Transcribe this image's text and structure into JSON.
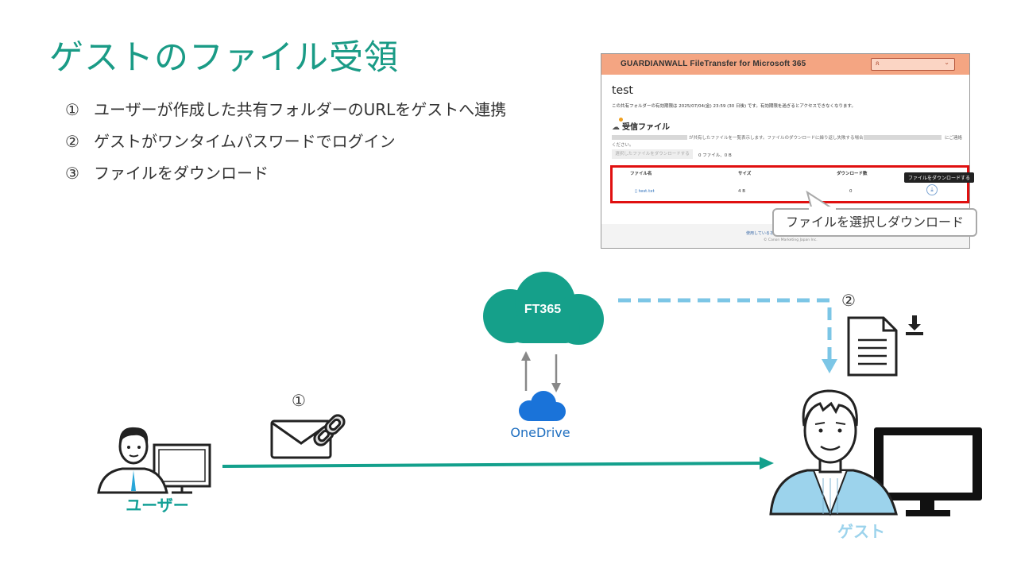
{
  "title": "ゲストのファイル受領",
  "steps": [
    {
      "num": "①",
      "text": "ユーザーが作成した共有フォルダーのURLをゲストへ連携"
    },
    {
      "num": "②",
      "text": "ゲストがワンタイムパスワードでログイン"
    },
    {
      "num": "③",
      "text": "ファイルをダウンロード"
    }
  ],
  "screenshot": {
    "brand": "GUARDIANWALL FileTransfer for Microsoft 365",
    "folder_name": "test",
    "notice": "この共有フォルダーの有効期限は 2025/07/04(金) 23:59 (30 日後) です。有効期限を過ぎるとアクセスできなくなります。",
    "section": "受信ファイル",
    "desc_mid": "が共有したファイルを一覧表示します。ファイルのダウンロードに繰り返し失敗する場合は、",
    "desc_end": "にご連絡",
    "desc_line2": "ください。",
    "download_selected": "選択したファイルをダウンロードする",
    "count": "0 ファイル、0 B",
    "col_name": "ファイル名",
    "col_size": "サイズ",
    "col_downloads": "ダウンロード数",
    "file_name": "test.txt",
    "file_size": "4 B",
    "file_downloads": "0",
    "tooltip": "ファイルをダウンロードする",
    "footer_link": "使用しているオ",
    "footer_copy": "© Canon Marketing Japan Inc."
  },
  "callout": "ファイルを選択しダウンロード",
  "cloud_label": "FT365",
  "onedrive_label": "OneDrive",
  "user_label": "ユーザー",
  "guest_label": "ゲスト",
  "marker_1": "①",
  "marker_2": "②",
  "colors": {
    "title": "#1a9b86",
    "cloud": "#15a08a",
    "arrow": "#13a08c",
    "dashed": "#7cc6e6",
    "guest_shirt": "#9cd3ec",
    "red_box": "#e01010"
  }
}
